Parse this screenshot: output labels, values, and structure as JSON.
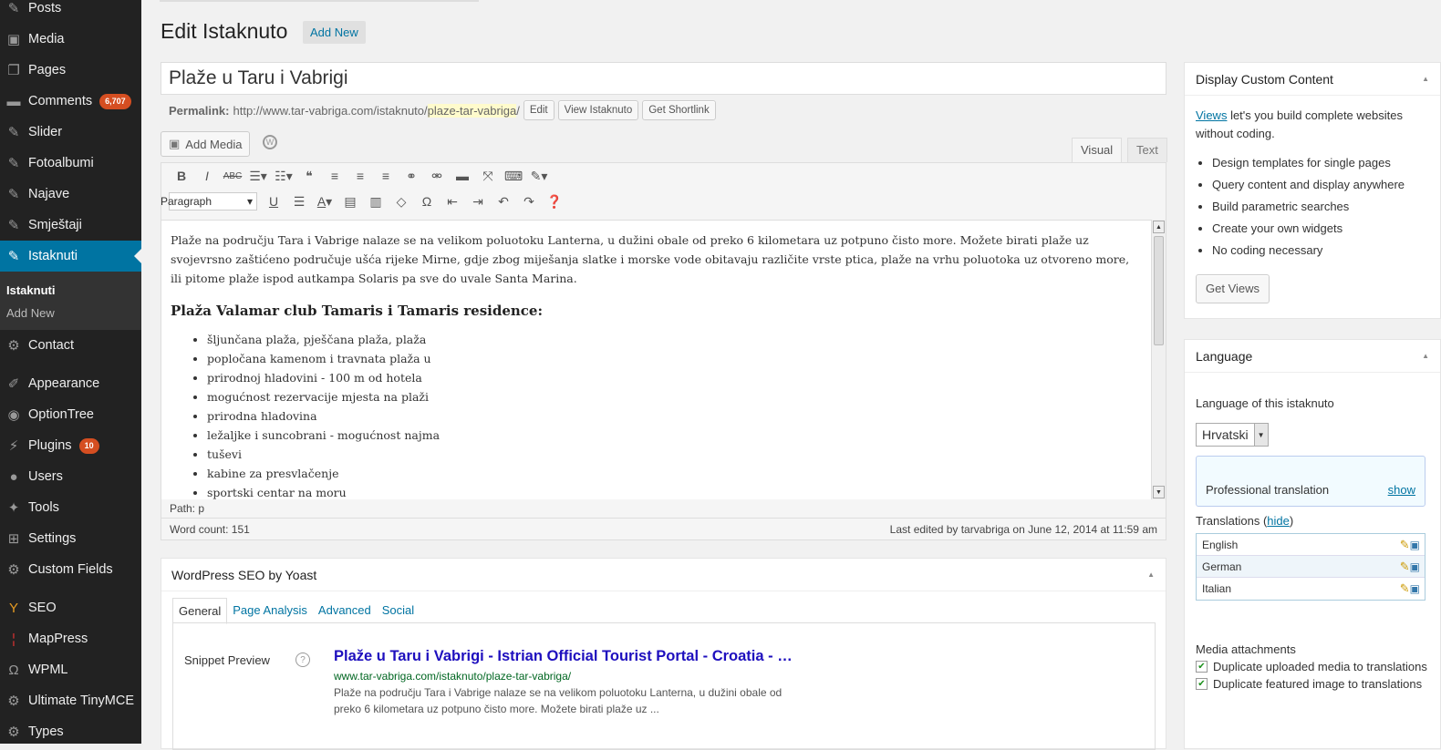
{
  "menu": {
    "posts": "Posts",
    "media": "Media",
    "pages": "Pages",
    "comments": "Comments",
    "comments_badge": "6,707",
    "slider": "Slider",
    "fotoalbumi": "Fotoalbumi",
    "najave": "Najave",
    "smjestaji": "Smještaji",
    "istaknuti": "Istaknuti",
    "sub_istaknuti": "Istaknuti",
    "sub_addnew": "Add New",
    "contact": "Contact",
    "appearance": "Appearance",
    "optiontree": "OptionTree",
    "plugins": "Plugins",
    "plugins_badge": "10",
    "users": "Users",
    "tools": "Tools",
    "settings": "Settings",
    "customfields": "Custom Fields",
    "seo": "SEO",
    "mappress": "MapPress",
    "wpml": "WPML",
    "tinymce": "Ultimate TinyMCE",
    "types": "Types"
  },
  "header": {
    "title": "Edit Istaknuto",
    "add_new": "Add New"
  },
  "post": {
    "title": "Plaže u Taru i Vabrigi",
    "perma_label": "Permalink:",
    "perma_base": "http://www.tar-vabriga.com/istaknuto/",
    "perma_slug": "plaze-tar-vabriga",
    "perma_end": "/",
    "btn_edit": "Edit",
    "btn_view": "View Istaknuto",
    "btn_short": "Get Shortlink"
  },
  "editor": {
    "add_media": "Add Media",
    "tab_visual": "Visual",
    "tab_text": "Text",
    "format": "Paragraph",
    "p1": "Plaže na području Tara i Vabrige nalaze se na velikom poluotoku Lanterna, u dužini obale od preko 6 kilometara uz potpuno čisto more. Možete birati plaže uz svojevrsno zaštićeno područuje ušća rijeke Mirne, gdje zbog miješanja slatke i morske vode obitavaju različite vrste ptica, plaže na vrhu poluotoka uz otvoreno more, ili pitome plaže ispod autkampa Solaris pa sve do uvale Santa Marina.",
    "h3": "Plaža Valamar club Tamaris i Tamaris residence:",
    "items": [
      "šljunčana plaža, pješčana plaža, plaža",
      "popločana kamenom i travnata plaža u",
      "prirodnoj hladovini - 100 m od hotela",
      "mogućnost rezervacije mjesta na plaži",
      "prirodna hladovina",
      "ležaljke i suncobrani - mogućnost najma",
      "tuševi",
      "kabine za presvlačenje",
      "sportski centar na moru"
    ],
    "path": "Path: p",
    "word_count": "Word count: 151",
    "last_edited": "Last edited by tarvabriga on June 12, 2014 at 11:59 am"
  },
  "seo": {
    "title": "WordPress SEO by Yoast",
    "tabs": [
      "General",
      "Page Analysis",
      "Advanced",
      "Social"
    ],
    "snippet_label": "Snippet Preview",
    "snippet_title": "Plaže u Taru i Vabrigi - Istrian Official Tourist Portal - Croatia - …",
    "snippet_url": "www.tar-vabriga.com/istaknuto/plaze-tar-vabriga/",
    "snippet_desc": "Plaže na području Tara i Vabrige nalaze se na velikom poluotoku Lanterna, u dužini obale od preko 6 kilometara uz potpuno čisto more. Možete birati plaže uz ..."
  },
  "dcc": {
    "title": "Display Custom Content",
    "link": "Views",
    "intro": " let's you build complete websites without coding.",
    "items": [
      "Design templates for single pages",
      "Query content and display anywhere",
      "Build parametric searches",
      "Create your own widgets",
      "No coding necessary"
    ],
    "button": "Get Views"
  },
  "language": {
    "title": "Language",
    "label": "Language of this istaknuto",
    "selected": "Hrvatski",
    "prof": "Professional translation",
    "show": "show",
    "translations": "Translations",
    "hide": "hide",
    "langs": [
      "English",
      "German",
      "Italian"
    ],
    "media_title": "Media attachments",
    "cb1": "Duplicate uploaded media to translations",
    "cb2": "Duplicate featured image to translations"
  }
}
